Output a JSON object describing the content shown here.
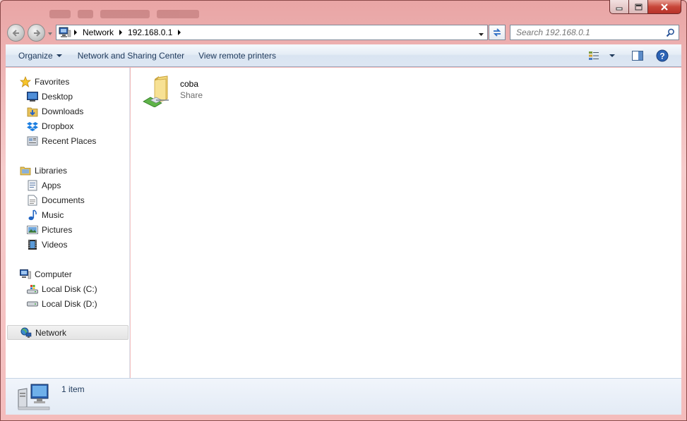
{
  "window": {
    "caption_buttons": [
      "minimize-icon",
      "maximize-icon",
      "close-icon"
    ]
  },
  "addressbar": {
    "breadcrumbs": [
      "Network",
      "192.168.0.1"
    ]
  },
  "search": {
    "placeholder": "Search 192.168.0.1"
  },
  "toolbar": {
    "organize_label": "Organize",
    "network_sharing_label": "Network and Sharing Center",
    "view_printers_label": "View remote printers"
  },
  "sidebar": {
    "favorites": {
      "label": "Favorites",
      "items": [
        {
          "label": "Desktop",
          "icon": "desktop-icon"
        },
        {
          "label": "Downloads",
          "icon": "downloads-icon"
        },
        {
          "label": "Dropbox",
          "icon": "dropbox-icon"
        },
        {
          "label": "Recent Places",
          "icon": "recent-places-icon"
        }
      ]
    },
    "libraries": {
      "label": "Libraries",
      "items": [
        {
          "label": "Apps",
          "icon": "apps-library-icon"
        },
        {
          "label": "Documents",
          "icon": "documents-icon"
        },
        {
          "label": "Music",
          "icon": "music-icon"
        },
        {
          "label": "Pictures",
          "icon": "pictures-icon"
        },
        {
          "label": "Videos",
          "icon": "videos-icon"
        }
      ]
    },
    "computer": {
      "label": "Computer",
      "items": [
        {
          "label": "Local Disk (C:)",
          "icon": "local-disk-c-icon"
        },
        {
          "label": "Local Disk (D:)",
          "icon": "local-disk-d-icon"
        }
      ]
    },
    "network": {
      "label": "Network",
      "selected": true
    }
  },
  "content": {
    "items": [
      {
        "name": "coba",
        "type": "Share",
        "icon": "shared-folder-icon"
      }
    ]
  },
  "details": {
    "count_text": "1 item"
  },
  "colors": {
    "frame": "#f4bcbc",
    "command_text": "#1e395b",
    "selection": "#e4e4e4"
  }
}
